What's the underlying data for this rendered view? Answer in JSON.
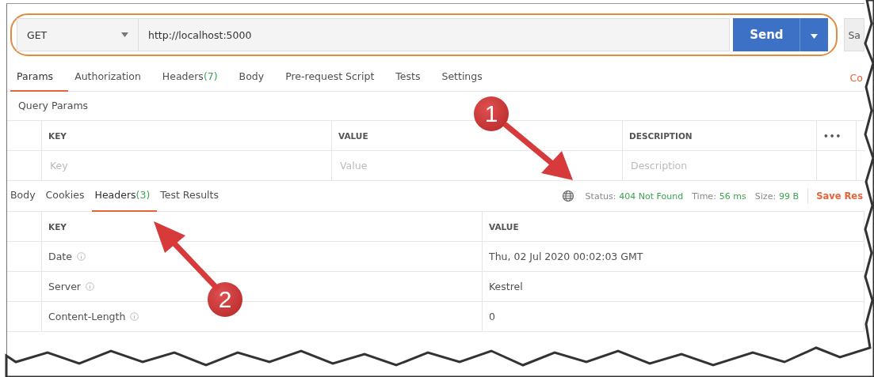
{
  "request": {
    "method": "GET",
    "url": "http://localhost:5000",
    "send": "Send",
    "save": "Sa"
  },
  "request_tabs": [
    {
      "label": "Params",
      "selected": true
    },
    {
      "label": "Authorization",
      "selected": false
    },
    {
      "label": "Headers",
      "count": "(7)",
      "selected": false
    },
    {
      "label": "Body",
      "selected": false
    },
    {
      "label": "Pre-request Script",
      "selected": false
    },
    {
      "label": "Tests",
      "selected": false
    },
    {
      "label": "Settings",
      "selected": false
    }
  ],
  "cookies_link": "Co",
  "query_params": {
    "title": "Query Params",
    "columns": [
      "KEY",
      "VALUE",
      "DESCRIPTION"
    ],
    "more": "•••",
    "placeholders": [
      "Key",
      "Value",
      "Description"
    ]
  },
  "response_tabs": [
    {
      "label": "Body",
      "selected": false
    },
    {
      "label": "Cookies",
      "selected": false
    },
    {
      "label": "Headers",
      "count": "(3)",
      "selected": true
    },
    {
      "label": "Test Results",
      "selected": false
    }
  ],
  "response_status": {
    "status_label": "Status:",
    "status": "404 Not Found",
    "time_label": "Time:",
    "time": "56 ms",
    "size_label": "Size:",
    "size": "99 B",
    "save": "Save Res"
  },
  "response_headers": {
    "columns": [
      "KEY",
      "VALUE"
    ],
    "rows": [
      {
        "key": "Date",
        "value": "Thu, 02 Jul 2020 00:02:03 GMT"
      },
      {
        "key": "Server",
        "value": "Kestrel"
      },
      {
        "key": "Content-Length",
        "value": "0"
      }
    ]
  },
  "callouts": [
    {
      "label": "1"
    },
    {
      "label": "2"
    }
  ]
}
